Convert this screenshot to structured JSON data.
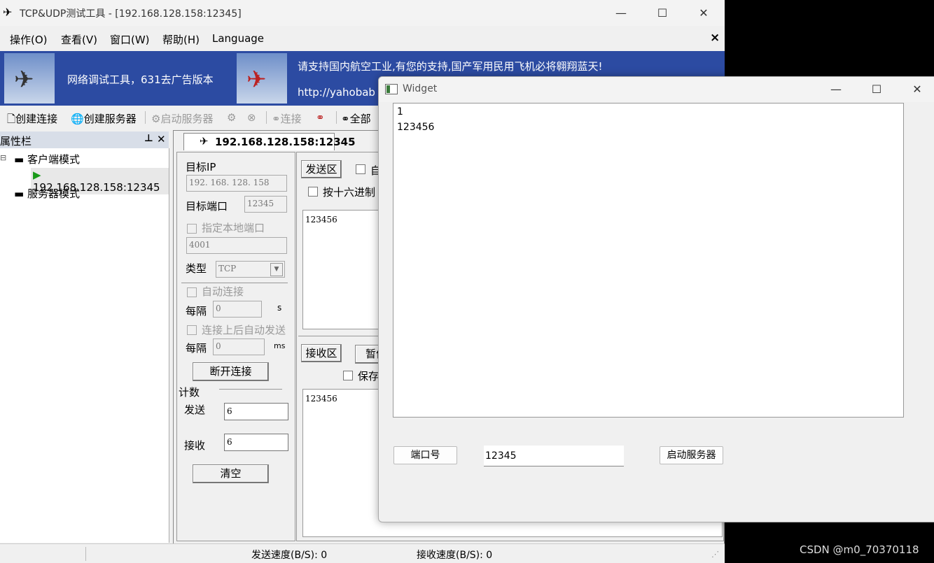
{
  "main_window": {
    "title": "TCP&UDP测试工具 - [192.168.128.158:12345]",
    "controls": {
      "minimize": "—",
      "maximize": "☐",
      "close": "✕"
    },
    "menu": [
      "操作(O)",
      "查看(V)",
      "窗口(W)",
      "帮助(H)",
      "Language"
    ],
    "menu_close": "×",
    "banner": {
      "left_text": "网络调试工具，631去广告版本",
      "right_text": "请支持国内航空工业,有您的支持,国产军用民用飞机必将翱翔蓝天!",
      "url": "http://yahobab"
    },
    "toolbar": {
      "create_connection": "创建连接",
      "create_server": "创建服务器",
      "start_server": "启动服务器",
      "connect": "连接",
      "all": "全部"
    },
    "properties_panel": {
      "title": "属性栏",
      "pin": "ᵖ",
      "close": "✕",
      "tree": {
        "client_mode": "客户端模式",
        "client_connection": "192.168.128.158:12345",
        "server_mode": "服务器模式"
      }
    },
    "tab_label": "192.168.128.158:12345",
    "config": {
      "target_ip_label": "目标IP",
      "target_ip_value": "192. 168. 128. 158",
      "target_port_label": "目标端口",
      "target_port_value": "12345",
      "local_port_label": "指定本地端口",
      "local_port_value": "4001",
      "type_label": "类型",
      "type_value": "TCP",
      "auto_connect_label": "自动连接",
      "interval_label": "每隔",
      "interval_value_1": "0",
      "unit_s": "s",
      "auto_send_label": "连接上后自动发送",
      "interval_value_2": "0",
      "unit_ms": "ms",
      "disconnect_button": "断开连接",
      "count_label": "计数",
      "send_label": "发送",
      "send_count": "6",
      "recv_label": "接收",
      "recv_count": "6",
      "clear_button": "清空"
    },
    "send_area": {
      "button": "发送区",
      "auto_check_label": "自",
      "hex_label": "按十六进制",
      "content": "123456"
    },
    "recv_area": {
      "button": "接收区",
      "pause_button": "暂停",
      "save_label": "保存",
      "content": "123456"
    },
    "status": {
      "send_speed": "发送速度(B/S): 0",
      "recv_speed": "接收速度(B/S): 0"
    }
  },
  "widget_window": {
    "title": "Widget",
    "controls": {
      "minimize": "—",
      "maximize": "☐",
      "close": "✕"
    },
    "display_lines": [
      "1",
      "123456"
    ],
    "port_label_button": "端口号",
    "port_value": "12345",
    "start_server_button": "启动服务器"
  },
  "watermark": "CSDN @m0_70370118"
}
